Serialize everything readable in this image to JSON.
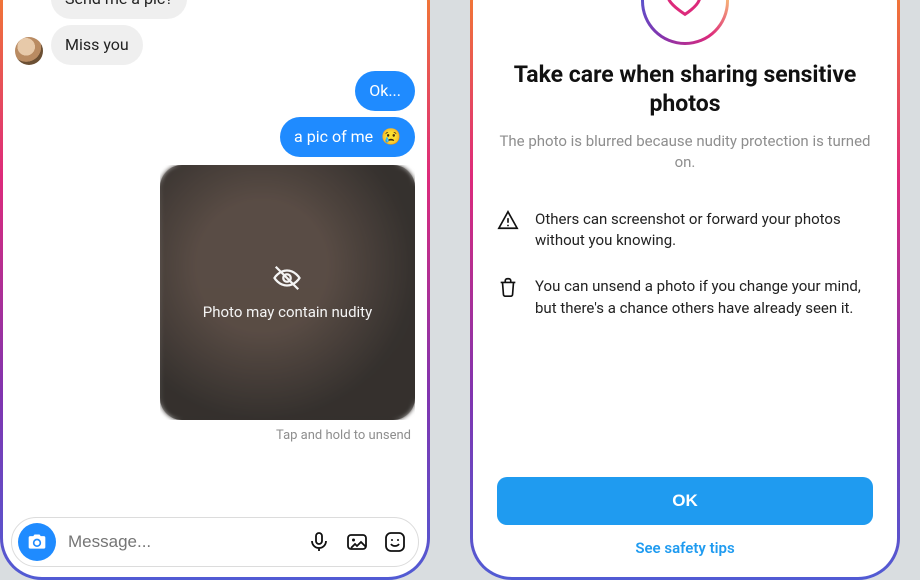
{
  "chat": {
    "incoming": [
      {
        "text": "Send me a pic?"
      },
      {
        "text": "Miss you"
      }
    ],
    "outgoing": [
      {
        "text": "Ok..."
      },
      {
        "text": "a pic of me",
        "emoji": "😢"
      }
    ],
    "photo_warning_label": "Photo may contain nudity",
    "unsend_hint": "Tap and hold to unsend",
    "composer_placeholder": "Message..."
  },
  "sheet": {
    "title": "Take care when sharing sensitive photos",
    "subtitle": "The photo is blurred because nudity protection is turned on.",
    "items": [
      {
        "icon": "warning-triangle-icon",
        "text": "Others can screenshot or forward your photos without you knowing."
      },
      {
        "icon": "trash-icon",
        "text": "You can unsend a photo if you change your mind, but there's a chance others have already seen it."
      }
    ],
    "ok_label": "OK",
    "tips_label": "See safety tips"
  },
  "colors": {
    "accent_blue": "#1f8bff",
    "link_blue": "#1f9bf0",
    "bubble_in": "#efefef",
    "text_muted": "#8e8e8e"
  }
}
